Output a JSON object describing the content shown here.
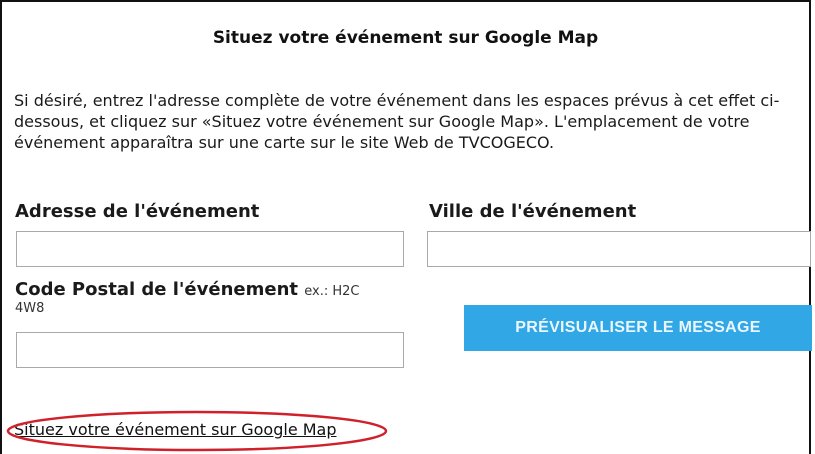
{
  "section": {
    "title": "Situez votre événement sur Google Map",
    "intro": "Si désiré, entrez l'adresse complète de votre événement dans les espaces prévus à cet effet ci-dessous, et cliquez sur «Situez votre événement sur Google Map». L'emplacement de votre événement apparaîtra sur une carte sur le site Web de TVCOGECO."
  },
  "form": {
    "address_label": "Adresse de l'événement",
    "address_value": "",
    "city_label": "Ville de l'événement",
    "city_value": "",
    "postal_label": "Code Postal de l'événement",
    "postal_hint_1": "ex.: H2C",
    "postal_hint_2": "4W8",
    "postal_value": ""
  },
  "actions": {
    "preview_label": "PRÉVISUALISER LE MESSAGE",
    "map_link_label": "Situez votre événement sur Google Map"
  },
  "colors": {
    "button_bg": "#31a7e6",
    "highlight": "#d0202a"
  }
}
